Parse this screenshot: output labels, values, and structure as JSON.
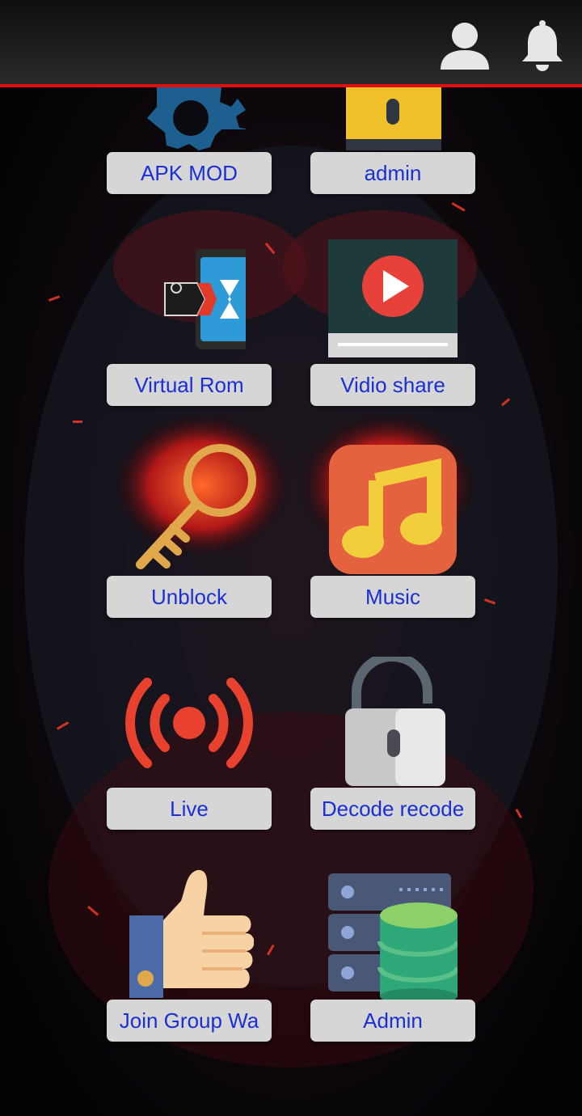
{
  "header": {
    "icons": [
      "user-icon",
      "bell-icon"
    ]
  },
  "tiles": [
    {
      "label": "APK MOD",
      "icon": "gear-icon"
    },
    {
      "label": "admin",
      "icon": "lock-icon"
    },
    {
      "label": "Virtual Rom",
      "icon": "virtual-app-icon"
    },
    {
      "label": "Vidio share",
      "icon": "video-play-icon"
    },
    {
      "label": "Unblock",
      "icon": "key-icon"
    },
    {
      "label": "Music",
      "icon": "music-note-icon"
    },
    {
      "label": "Live",
      "icon": "broadcast-icon"
    },
    {
      "label": "Decode recode",
      "icon": "padlock-open-icon"
    },
    {
      "label": "Join Group Wa",
      "icon": "thumbs-up-icon"
    },
    {
      "label": "Admin",
      "icon": "database-server-icon"
    }
  ],
  "colors": {
    "accent_line": "#e01010",
    "button_bg": "#d6d6d6",
    "button_text": "#1a2fd6"
  }
}
